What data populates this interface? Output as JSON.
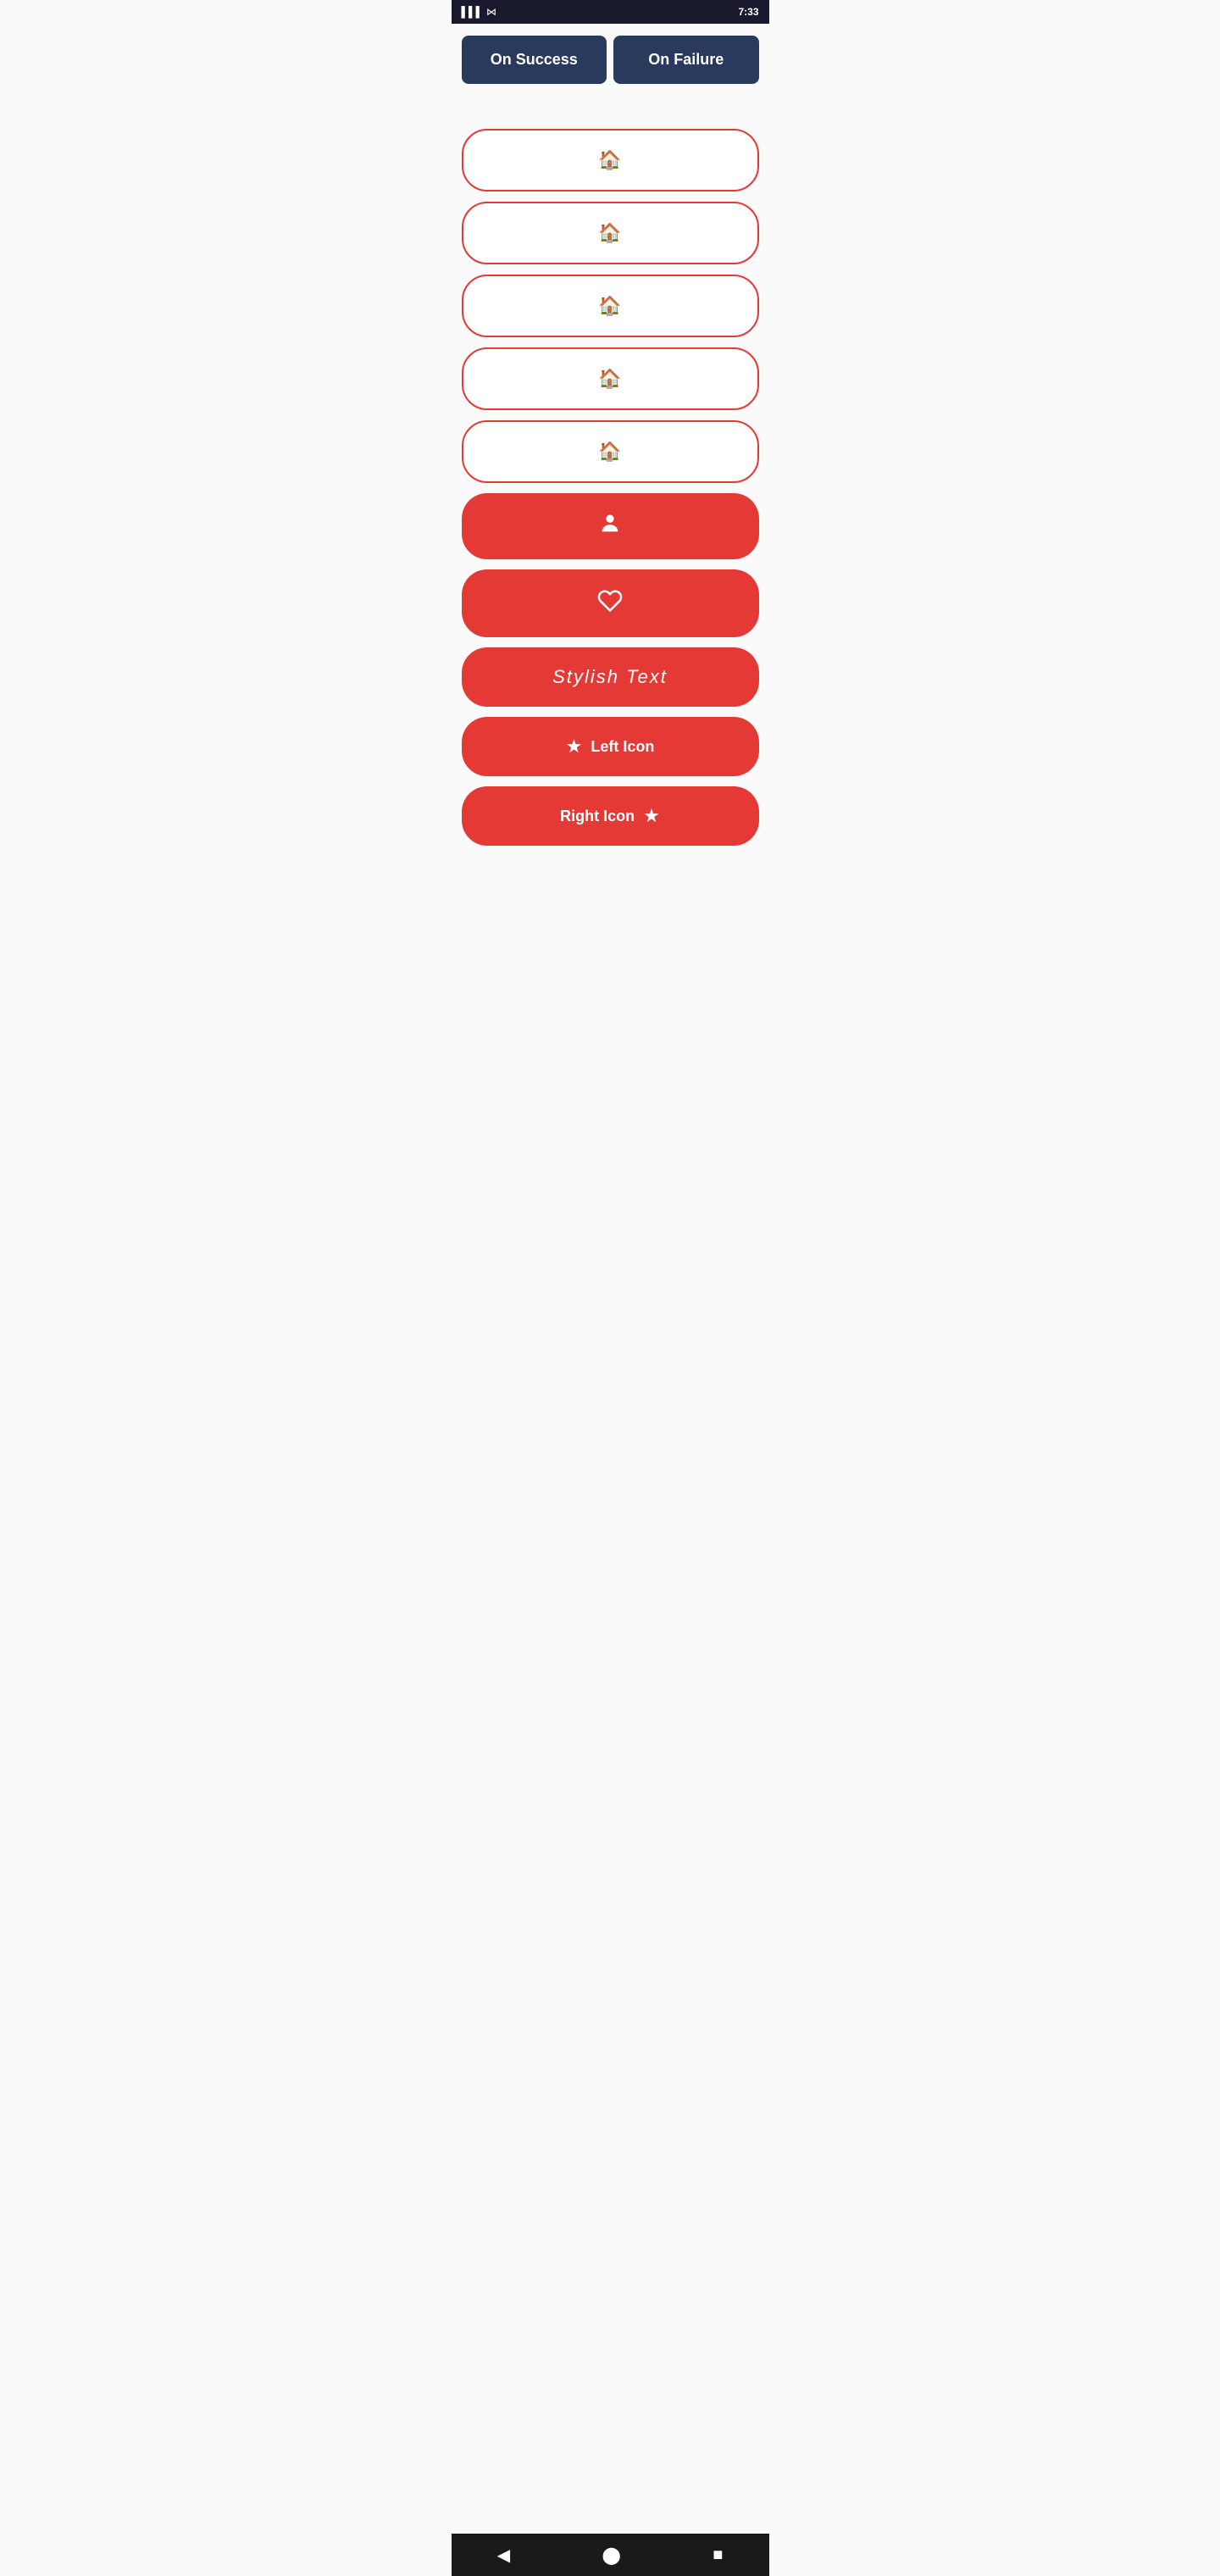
{
  "statusBar": {
    "time": "7:33",
    "icons": [
      "signal",
      "wifi",
      "battery"
    ]
  },
  "topButtons": {
    "successLabel": "On Success",
    "failureLabel": "On Failure"
  },
  "outlineButtons": [
    {
      "icon": "🏠",
      "label": "",
      "type": "outline"
    },
    {
      "icon": "🏠",
      "label": "",
      "type": "outline"
    },
    {
      "icon": "🏠",
      "label": "",
      "type": "outline"
    },
    {
      "icon": "🏠",
      "label": "",
      "type": "outline"
    },
    {
      "icon": "🏠",
      "label": "",
      "type": "outline"
    }
  ],
  "filledButtons": [
    {
      "icon": "👤",
      "label": "",
      "type": "filled"
    },
    {
      "icon": "🤍",
      "label": "",
      "type": "filled"
    },
    {
      "icon": "",
      "label": "Stylish Text",
      "type": "filled-stylish"
    },
    {
      "icon": "★",
      "label": "Left Icon",
      "type": "filled-icon-left"
    },
    {
      "icon": "★",
      "label": "Right Icon",
      "type": "filled-icon-right"
    }
  ],
  "navBar": {
    "backIcon": "◀",
    "homeIcon": "⬤",
    "squareIcon": "■"
  },
  "colors": {
    "red": "#e53935",
    "darkBlue": "#2a3a5c",
    "white": "#ffffff",
    "background": "#fafafa"
  }
}
